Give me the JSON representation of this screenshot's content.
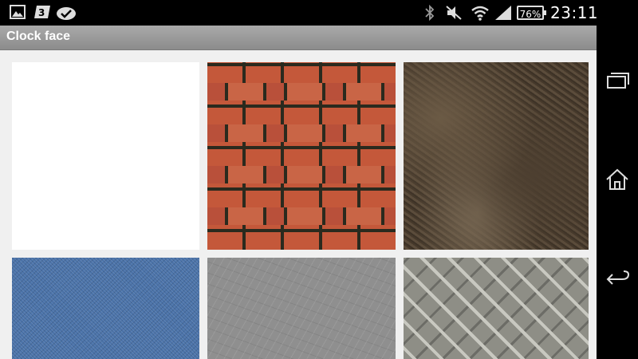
{
  "status_bar": {
    "time": "23:11",
    "battery_level": "76%",
    "icons": [
      "image-icon",
      "sim-3-icon",
      "check-cloud-icon",
      "bluetooth-icon",
      "mute-icon",
      "wifi-icon",
      "signal-icon"
    ]
  },
  "action_bar": {
    "title": "Clock face"
  },
  "gallery": {
    "tiles": [
      "blank",
      "brick",
      "fur",
      "denim",
      "scratched-metal",
      "diamond-plate"
    ]
  },
  "nav_bar": {
    "buttons": [
      "recent-apps",
      "home",
      "back"
    ]
  }
}
